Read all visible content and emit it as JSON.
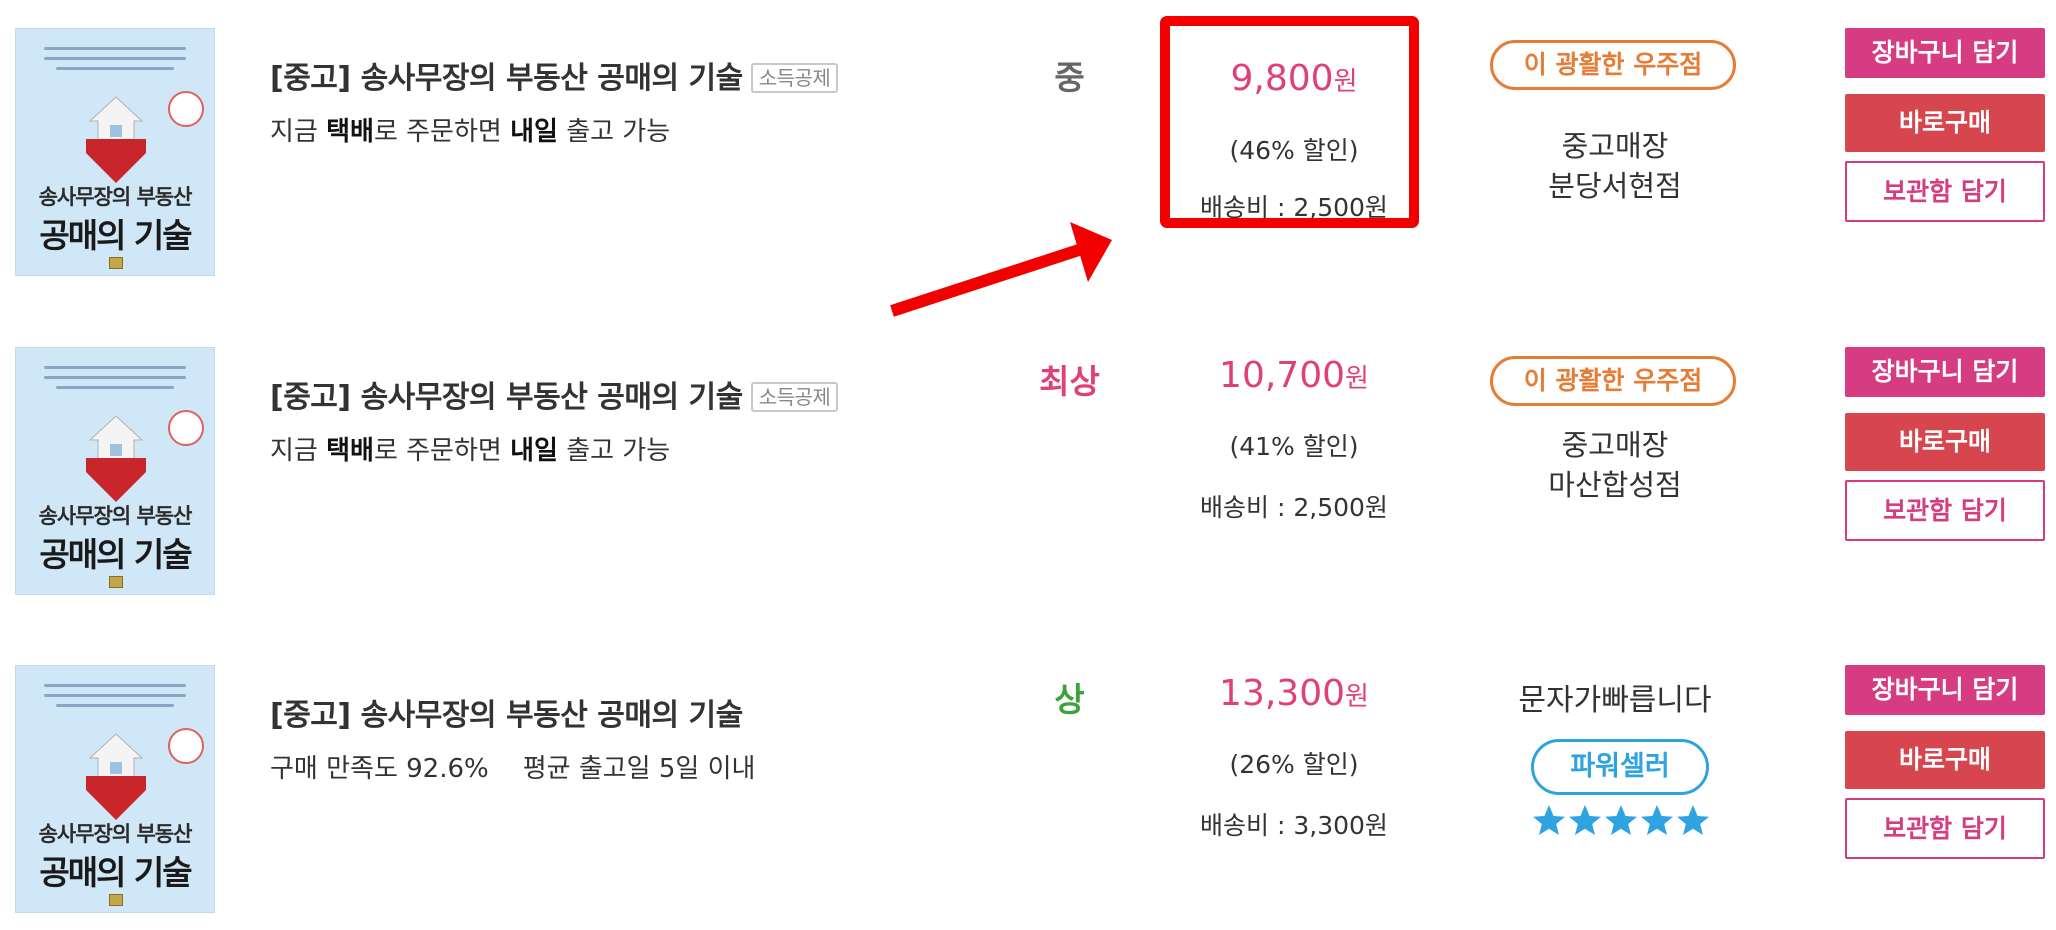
{
  "cover": {
    "small_text": "송사무장의 부동산",
    "big_text": "공매의 기술"
  },
  "listings": [
    {
      "title": "[중고] 송사무장의 부동산 공매의 기술",
      "tax_badge": "소득공제",
      "delivery": {
        "pre": "지금 ",
        "bold1": "택배",
        "mid": "로 주문하면 ",
        "bold2": "내일",
        "post": " 출고 가능"
      },
      "grade": "중",
      "grade_color": "#666666",
      "price": "9,800",
      "currency": "원",
      "discount": "(46% 할인)",
      "shipping": "배송비 : 2,500원",
      "seller_badge": "이 광활한 우주점",
      "store_line1": "중고매장",
      "store_line2": "분당서현점",
      "buttons": {
        "cart": "장바구니 담기",
        "buy": "바로구매",
        "keep": "보관함 담기"
      }
    },
    {
      "title": "[중고] 송사무장의 부동산 공매의 기술",
      "tax_badge": "소득공제",
      "delivery": {
        "pre": "지금 ",
        "bold1": "택배",
        "mid": "로 주문하면 ",
        "bold2": "내일",
        "post": " 출고 가능"
      },
      "grade": "최상",
      "grade_color": "#e0407a",
      "price": "10,700",
      "currency": "원",
      "discount": "(41% 할인)",
      "shipping": "배송비 : 2,500원",
      "seller_badge": "이 광활한 우주점",
      "store_line1": "중고매장",
      "store_line2": "마산합성점",
      "buttons": {
        "cart": "장바구니 담기",
        "buy": "바로구매",
        "keep": "보관함 담기"
      }
    },
    {
      "title": "[중고] 송사무장의 부동산 공매의 기술",
      "satisfaction": "구매 만족도 92.6%",
      "avg_ship": "평균 출고일 5일 이내",
      "grade": "상",
      "grade_color": "#3ca23c",
      "price": "13,300",
      "currency": "원",
      "discount": "(26% 할인)",
      "shipping": "배송비 : 3,300원",
      "seller_name": "문자가빠릅니다",
      "seller_badge": "파워셀러",
      "rating_stars": 5,
      "buttons": {
        "cart": "장바구니 담기",
        "buy": "바로구매",
        "keep": "보관함 담기"
      }
    }
  ],
  "colors": {
    "price": "#e0407a",
    "cart_button": "#d63c81",
    "buy_button": "#d7464f",
    "highlight_box": "#f20000",
    "seller_badge": "#e57d36",
    "power_seller": "#2fa3e0",
    "star": "#2fa3e0"
  }
}
